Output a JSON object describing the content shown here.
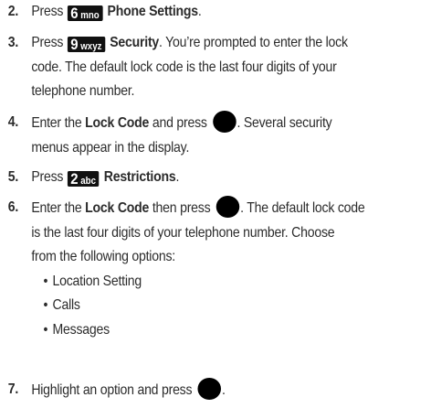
{
  "steps": [
    {
      "number": "2.",
      "lines": [
        {
          "pre": "Press ",
          "key": {
            "digit": "6",
            "letters": "mno"
          },
          "bold": "Phone Settings",
          "post": "."
        }
      ]
    },
    {
      "number": "3.",
      "lines": [
        {
          "pre": "Press ",
          "key": {
            "digit": "9",
            "letters": "wxyz"
          },
          "bold": "Security",
          "post": ". You’re prompted to enter the lock"
        },
        {
          "text": "code. The default lock code is the last four digits of your"
        },
        {
          "text": "telephone number."
        }
      ]
    },
    {
      "number": "4.",
      "lines": [
        {
          "pre": "Enter the ",
          "bold": "Lock Code",
          "mid": " and press ",
          "button": "ok-button-icon",
          "post": ". Several security"
        },
        {
          "text": "menus appear in the display."
        }
      ]
    },
    {
      "number": "5.",
      "lines": [
        {
          "pre": "Press ",
          "key": {
            "digit": "2",
            "letters": "abc"
          },
          "bold": "Restrictions",
          "post": "."
        }
      ]
    },
    {
      "number": "6.",
      "lines": [
        {
          "pre": "Enter the ",
          "bold": "Lock Code",
          "mid": " then press ",
          "button": "ok-button-icon",
          "post": ". The default lock code"
        },
        {
          "text": "is the last four digits of your telephone number. Choose"
        },
        {
          "text": "from the following options:"
        }
      ],
      "bullet_symbol": "•",
      "bullets": [
        "Location Setting",
        "Calls",
        "Messages"
      ]
    },
    {
      "number": "7.",
      "lines": [
        {
          "pre": "Highlight an option and press ",
          "button": "ok-button-icon",
          "post": "."
        }
      ]
    }
  ]
}
